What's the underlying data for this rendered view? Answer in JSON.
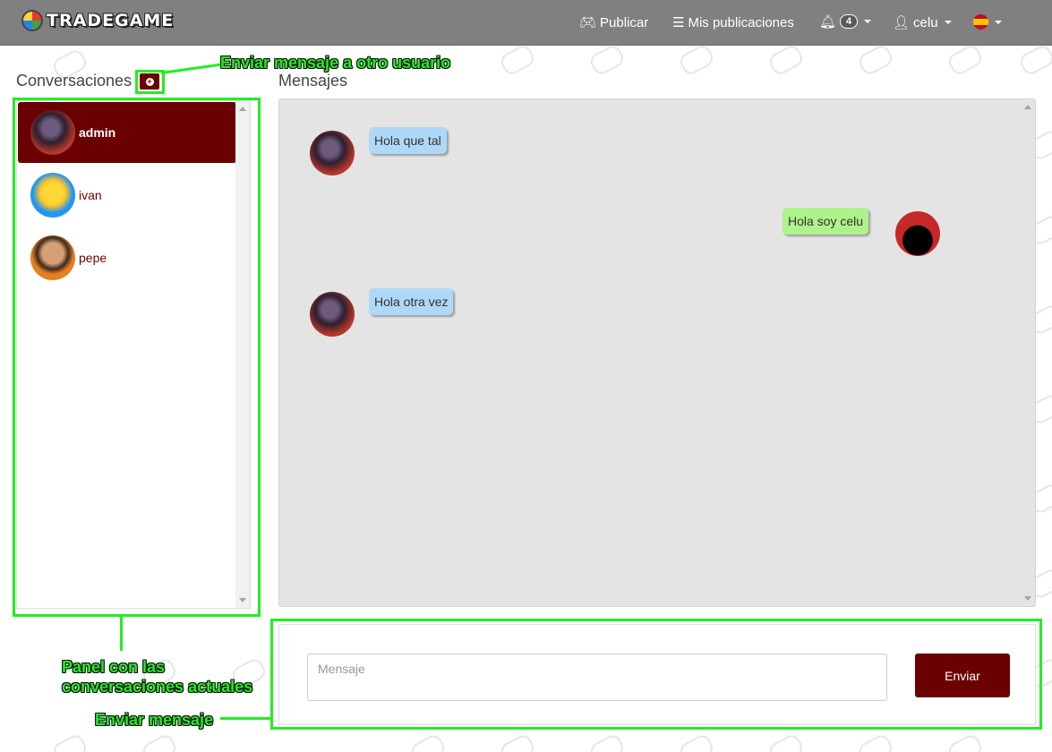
{
  "navbar": {
    "brand": "TRADEGAME",
    "publicar": "Publicar",
    "mis_publicaciones": "Mis publicaciones",
    "notifications_count": "4",
    "user": "celu",
    "language_flag": "flag-spain-icon"
  },
  "conversations": {
    "title": "Conversaciones",
    "items": [
      {
        "name": "admin",
        "active": true
      },
      {
        "name": "ivan",
        "active": false
      },
      {
        "name": "pepe",
        "active": false
      }
    ]
  },
  "messages": {
    "title": "Mensajes",
    "items": [
      {
        "text": "Hola que tal",
        "direction": "in",
        "from": "admin"
      },
      {
        "text": "Hola soy celu",
        "direction": "out",
        "from": "celu"
      },
      {
        "text": "Hola otra vez",
        "direction": "in",
        "from": "admin"
      }
    ]
  },
  "compose": {
    "placeholder": "Mensaje",
    "send_label": "Enviar"
  },
  "annotations": {
    "new_message": "Enviar mensaje a otro usuario",
    "conversations_panel_line1": "Panel con las",
    "conversations_panel_line2": "conversaciones actuales",
    "send_message": "Enviar mensaje"
  },
  "colors": {
    "navbar": "#808080",
    "accent": "#6b0000",
    "annotation": "#22ee22",
    "incoming_bubble": "#aed8f7",
    "outgoing_bubble": "#aef28a"
  }
}
